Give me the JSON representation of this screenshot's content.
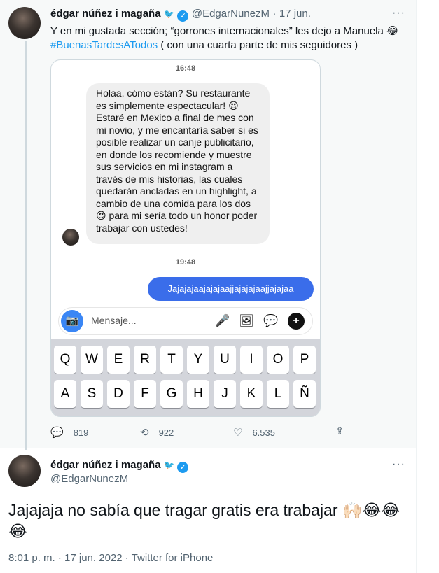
{
  "reply_tweet": {
    "author_name": "édgar núñez i magaña",
    "handle": "@EdgarNunezM",
    "date": "17 jun.",
    "text_line1": "Y en mi gustada sección; “gorrones internacionales” les dejo a Manuela 😂",
    "hashtag": "#BuenasTardesATodos",
    "text_after_hashtag": " ( con una cuarta parte de mis seguidores )",
    "replies": "819",
    "retweets": "922",
    "likes": "6.535"
  },
  "screenshot": {
    "time_1": "16:48",
    "incoming_message": "Holaa, cómo están? Su restaurante es simplemente espectacular! 😍\nEstaré en Mexico a final de mes con mi novio, y me encantaría saber si es posible realizar un canje publicitario, en donde los recomiende y muestre sus servicios en mi instagram a través de mis historias, las cuales quedarán ancladas en un highlight, a cambio de una comida para los dos 😍 para mi sería todo un honor poder trabajar con ustedes!",
    "time_2": "19:48",
    "outgoing_message": "Jajajajaajajajaajjajajajaajjajajaa",
    "composer_placeholder": "Mensaje...",
    "keyboard_row1": [
      "Q",
      "W",
      "E",
      "R",
      "T",
      "Y",
      "U",
      "I",
      "O",
      "P"
    ],
    "keyboard_row2": [
      "A",
      "S",
      "D",
      "F",
      "G",
      "H",
      "J",
      "K",
      "L",
      "Ñ"
    ]
  },
  "main_tweet": {
    "author_name": "édgar núñez i magaña",
    "handle": "@EdgarNunezM",
    "text": "Jajajaja no sabía que tragar gratis era trabajar 🙌🏻😂😂\n😂",
    "timestamp": "8:01 p. m. · 17 jun. 2022 · Twitter for iPhone"
  },
  "icons": {
    "bird": "🐦",
    "verified": "✓",
    "more": "···",
    "reply": "💬",
    "retweet": "⟲",
    "like": "♡",
    "share": "⇪",
    "camera": "📷",
    "mic": "🎤",
    "gallery": "🖼",
    "sticker": "💬",
    "plus": "+"
  },
  "colors": {
    "accent": "#1d9bf0",
    "ig_bubble_out": "#3a6dea",
    "ig_bubble_in": "#efefef",
    "keyboard_bg": "#d3d5db"
  }
}
